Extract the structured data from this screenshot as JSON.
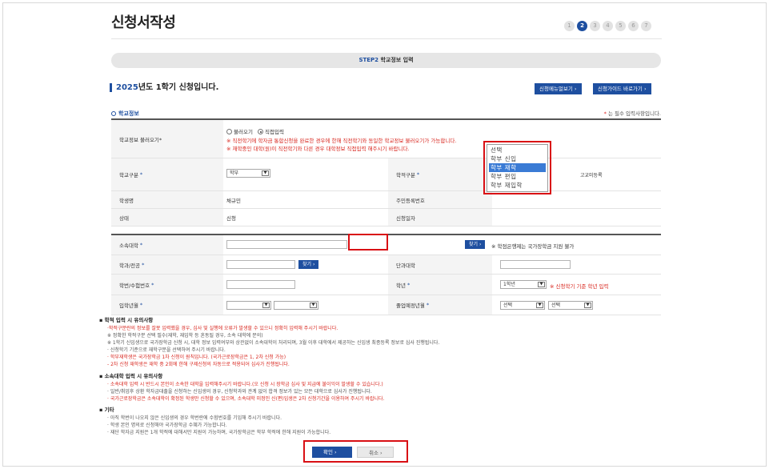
{
  "page": {
    "title": "신청서작성",
    "steps": [
      "1",
      "2",
      "3",
      "4",
      "5",
      "6",
      "7"
    ],
    "active_step_index": 1
  },
  "step_bar": {
    "prefix": "STEP2",
    "label": "학교정보 입력"
  },
  "semester": {
    "year": "2025",
    "text": "년도 1학기 신청입니다."
  },
  "header_buttons": {
    "menu": "신청메뉴얼보기 ›",
    "guide": "신청가이드 바로가기 ›"
  },
  "section": {
    "title": "학교정보",
    "required_note_star": "*",
    "required_note": " 는 필수 입력사항입니다."
  },
  "form1": {
    "load_label": "학교정보 불러오기*",
    "load_option1": "불러오기",
    "load_option2": "직접입력",
    "load_note1": "※ 직전학기에 학자금 통합신청을 완료한 경우에 한해 직전학기와 동일한 학교정보 불러오기가 가능합니다.",
    "load_note2": "※ 재학중인 대학(원)이 직전학기와 다른 경우 대학정보 직접입력 해주시기 바랍니다.",
    "school_type_label": "학교구분",
    "school_type_value": "학부",
    "student_type_label": "학적구분",
    "student_type_extra": "고교미등록",
    "name_label": "학생명",
    "name_value": "채규민",
    "rrn_label": "주민등록번호",
    "status_label": "상태",
    "status_value": "신청",
    "apply_date_label": "신청일자",
    "required_mark": "*"
  },
  "dropdown": {
    "options": [
      "선택",
      "학부 신입",
      "학부 재학",
      "학부 편입",
      "학부 재입학"
    ],
    "highlighted_index": 2
  },
  "form2": {
    "univ_label": "소속대학",
    "univ_search_btn": "찾기 ›",
    "univ_note": "※ 학점은행제는 국가장학금 지원 불가",
    "dept_label": "학과/전공",
    "dept_search_btn": "찾기 ›",
    "college_label": "단과대학",
    "student_no_label": "학번/수험번호",
    "grade_label": "학년",
    "grade_value": "1학년",
    "grade_note": "※ 신청학기 기준 학년 입력",
    "admission_label": "입학년월",
    "graduation_label": "졸업예정년월",
    "graduation_year": "선택",
    "graduation_month": "선택",
    "required_mark": "*"
  },
  "notes": {
    "academic_title": "학적 입력 시 유의사항",
    "academic_items": [
      "·학적구분란의 정보를 잘못 입력했을 경우, 심사 및 실행에 오류가 발생할 수 있으니 정확히 입력해 주시기 바랍니다.",
      "※ 정확한 학적구분 선택 필수(재학, 재입학 등 혼동될 경우, 소속 대학에 문의)",
      "※ 1학기 신입생으로 국가장학금 신청 시, 대학 정보 입력여부와 상관없이 소속대학이 처리되며, 3월 이후 대학에서 제공하는 신입생 최종등록 정보로 심사 진행됩니다.",
      "· 신청학기 기준으로 재학구분을 선택하여 주시기 바랍니다.",
      "· 학부재학생은 국가장학금 1차 신청이 원칙입니다. (국가근로장학금은 1, 2차 신청 가능)",
      "- 2차 신청 재학생은 재학 중 2회에 한해 구제신청의 자동으로 적용되어 심사가 진행됩니다."
    ],
    "academic_red": [
      true,
      false,
      false,
      false,
      true,
      true
    ],
    "univ_title": "소속대학 입력 시 유의사항",
    "univ_items": [
      "· 소속대학 입력 시 반드시 본인이 소속한 대학을 입력해주시기 바랍니다.(오 신청 시 장학금 심사 및 지급에 불이익이 발생할 수 있습니다.)",
      "· 일반/취업후 상환 학자금대출을 신청하는 신입생의 경우, 신청학과와 관계 없이 합격 정보가 있는 모든 대학으로 심사가 진행됩니다.",
      "· 국가근로장학금은 소속대학이 확정된 학생만 신청할 수 있으며, 소속대학 미정인 신(편)입생은 2차 신청기간을 이용하여 주시기 바랍니다."
    ],
    "univ_red": [
      true,
      false,
      true
    ],
    "etc_title": "기타",
    "etc_items": [
      "· 아직 학번이 나오지 않은 신입생의 경우 학번란에 수험번호를 기입해 주시기 바랍니다.",
      "· 학생 본인 명의로 신청해야 국가장학금 수혜가 가능합니다.",
      "· 재단 학자금 지원은 1개 학적에 대해서만 지원이 가능하며, 국가장학금은 학부 학적에 한해 지원이 가능합니다."
    ],
    "bullet": "▪"
  },
  "bottom": {
    "confirm": "확인 ›",
    "cancel": "취소 ›"
  },
  "colors": {
    "accent": "#1e4fa0",
    "highlight_box": "#d90f14",
    "warning_text": "#d8261e"
  }
}
